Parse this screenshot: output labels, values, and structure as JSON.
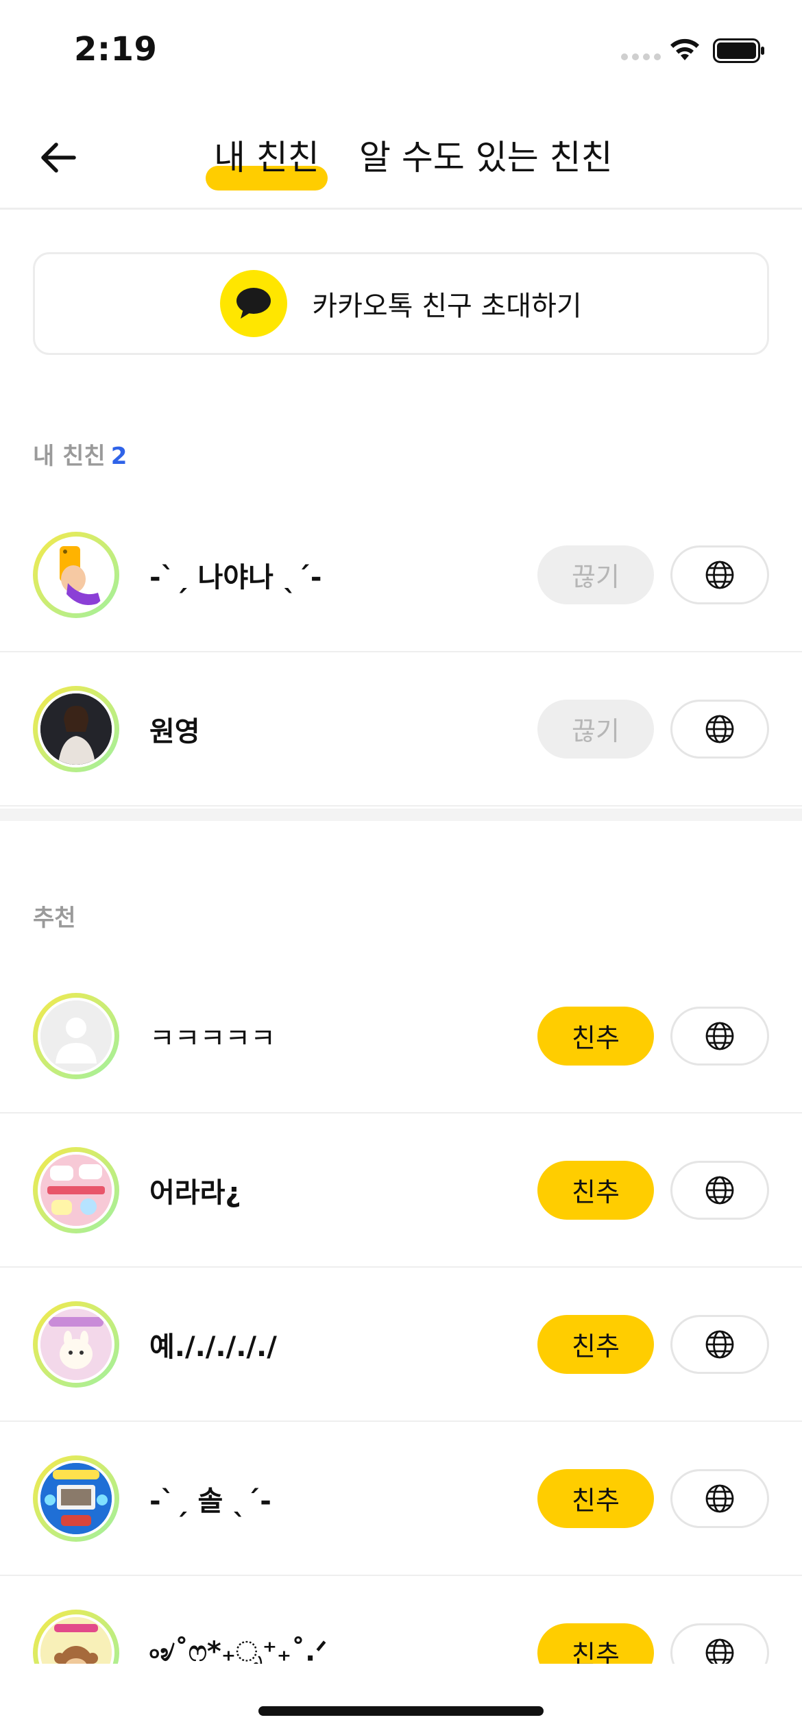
{
  "status_bar": {
    "time": "2:19"
  },
  "header": {
    "tabs": [
      {
        "label": "내 친친",
        "selected": true
      },
      {
        "label": "알 수도 있는 친친",
        "selected": false
      }
    ],
    "accent_color": "#ffcd00"
  },
  "invite": {
    "label": "카카오톡 친구 초대하기",
    "icon": "kakaotalk-bubble-icon"
  },
  "my_friends": {
    "title": "내 친친",
    "count": "2",
    "items": [
      {
        "name": "-ˋˏ 나야나 ˎˊ-",
        "action_label": "끊기",
        "action_enabled": false,
        "avatar": "hand-phone-emoji"
      },
      {
        "name": "원영",
        "action_label": "끊기",
        "action_enabled": false,
        "avatar": "photo"
      }
    ]
  },
  "recommend": {
    "title": "추천",
    "items": [
      {
        "name": "ㅋㅋㅋㅋㅋ",
        "action_label": "친추",
        "avatar": "default"
      },
      {
        "name": "어라라¿",
        "action_label": "친추",
        "avatar": "sticker-pink"
      },
      {
        "name": "예./././././",
        "action_label": "친추",
        "avatar": "sticker-bunny"
      },
      {
        "name": "-ˋˏ 솔 ˎˊ-",
        "action_label": "친추",
        "avatar": "sticker-blue"
      },
      {
        "name": "৹৶˚ෆ*₊ೃ⁺₊˚.ᐟ",
        "action_label": "친추",
        "avatar": "sticker-monkey"
      }
    ]
  },
  "colors": {
    "count_blue": "#2f63e8",
    "disabled_bg": "#eeeeee",
    "kakao_yellow": "#ffe600"
  }
}
